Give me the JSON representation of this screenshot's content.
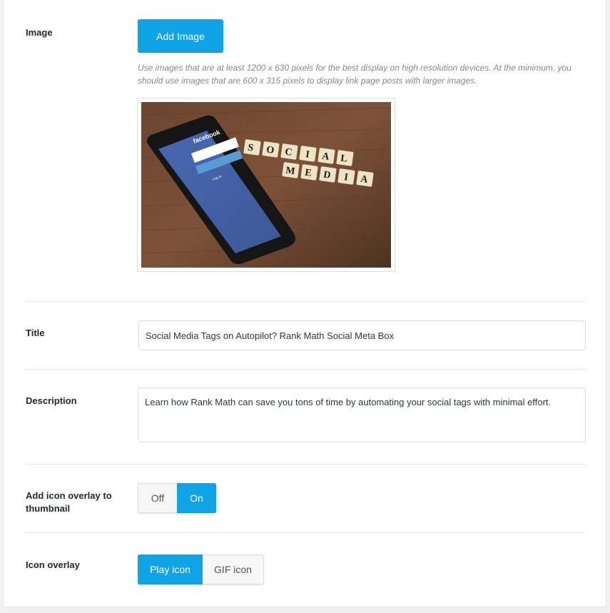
{
  "image_field": {
    "label": "Image",
    "button_label": "Add Image",
    "hint": "Use images that are at least 1200 x 630 pixels for the best display on high resolution devices. At the minimum, you should use images that are 600 x 315 pixels to display link page posts with larger images.",
    "preview": {
      "phone_app": "facebook",
      "login_label": "Log In",
      "tiles_row1": [
        "S",
        "O",
        "C",
        "I",
        "A",
        "L"
      ],
      "tiles_row2": [
        "M",
        "E",
        "D",
        "I",
        "A"
      ]
    }
  },
  "title_field": {
    "label": "Title",
    "value": "Social Media Tags on Autopilot? Rank Math Social Meta Box"
  },
  "description_field": {
    "label": "Description",
    "value": "Learn how Rank Math can save you tons of time by automating your social tags with minimal effort."
  },
  "overlay_toggle": {
    "label": "Add icon overlay to thumbnail",
    "options": [
      "Off",
      "On"
    ],
    "selected": "On"
  },
  "icon_overlay": {
    "label": "Icon overlay",
    "options": [
      "Play icon",
      "GIF icon"
    ],
    "selected": "Play icon"
  },
  "colors": {
    "accent": "#10a3e6",
    "background": "#f1f1f1",
    "panel": "#ffffff"
  }
}
